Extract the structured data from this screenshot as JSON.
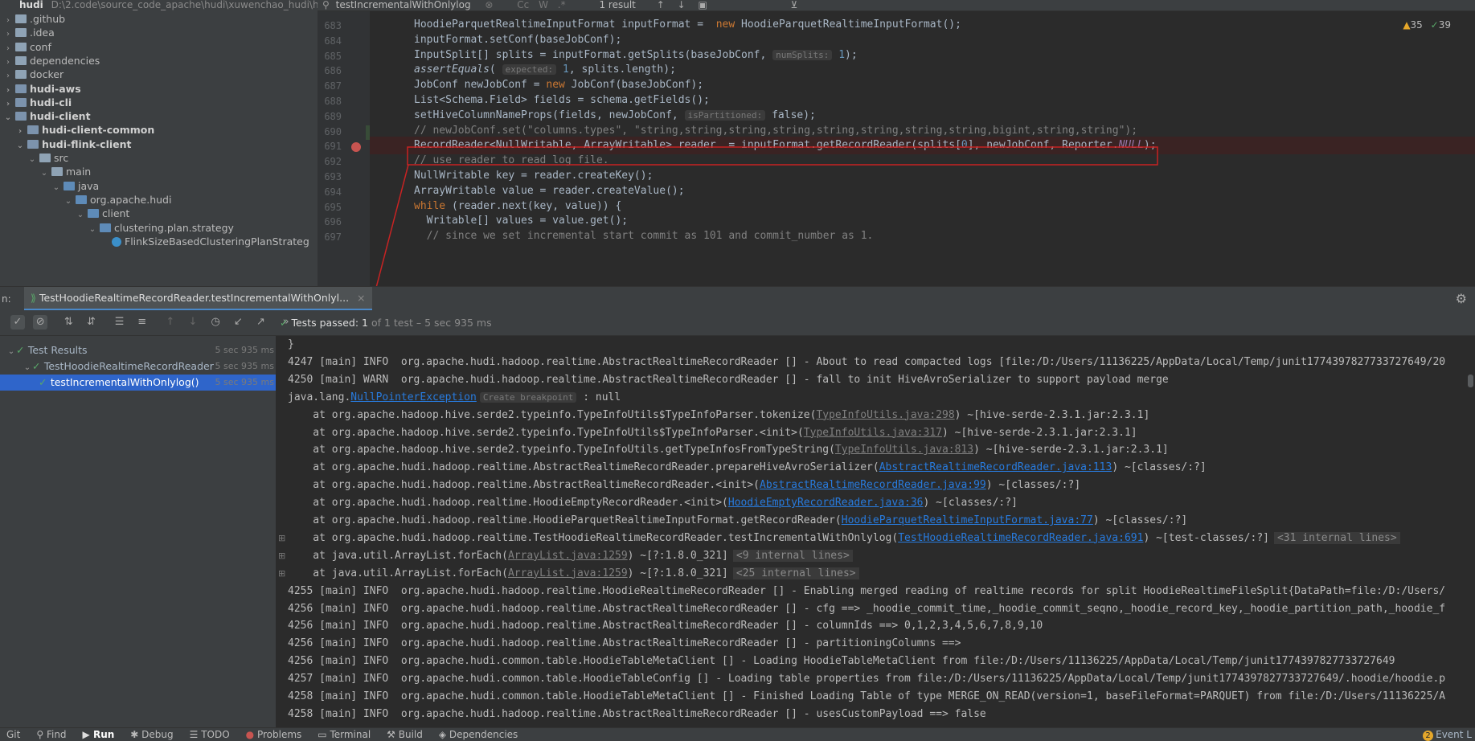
{
  "project": {
    "name": "hudi",
    "path": "D:\\2.code\\source_code_apache\\hudi\\xuwenchao_hudi\\hu",
    "tree": [
      {
        "label": ".github",
        "level": 0,
        "bold": false,
        "arrow": "right"
      },
      {
        "label": ".idea",
        "level": 0,
        "bold": false,
        "arrow": "right"
      },
      {
        "label": "conf",
        "level": 0,
        "bold": false,
        "arrow": "right"
      },
      {
        "label": "dependencies",
        "level": 0,
        "bold": false,
        "arrow": "right"
      },
      {
        "label": "docker",
        "level": 0,
        "bold": false,
        "arrow": "right"
      },
      {
        "label": "hudi-aws",
        "level": 0,
        "bold": true,
        "arrow": "right"
      },
      {
        "label": "hudi-cli",
        "level": 0,
        "bold": true,
        "arrow": "right"
      },
      {
        "label": "hudi-client",
        "level": 0,
        "bold": true,
        "arrow": "down"
      },
      {
        "label": "hudi-client-common",
        "level": 1,
        "bold": true,
        "arrow": "right"
      },
      {
        "label": "hudi-flink-client",
        "level": 1,
        "bold": true,
        "arrow": "down"
      },
      {
        "label": "src",
        "level": 2,
        "bold": false,
        "arrow": "down"
      },
      {
        "label": "main",
        "level": 3,
        "bold": false,
        "arrow": "down"
      },
      {
        "label": "java",
        "level": 4,
        "bold": false,
        "arrow": "down"
      },
      {
        "label": "org.apache.hudi",
        "level": 5,
        "bold": false,
        "arrow": "down"
      },
      {
        "label": "client",
        "level": 6,
        "bold": false,
        "arrow": "down"
      },
      {
        "label": "clustering.plan.strategy",
        "level": 7,
        "bold": false,
        "arrow": "down"
      },
      {
        "label": "FlinkSizeBasedClusteringPlanStrateg",
        "level": 8,
        "bold": false,
        "arrow": "none"
      }
    ]
  },
  "search": {
    "query": "testIncrementalWithOnlylog",
    "result": "1 result",
    "case": "Cc",
    "word": "W",
    "regex": ".*"
  },
  "inspections": {
    "warnings": "35",
    "ok": "39"
  },
  "code": {
    "lines": [
      {
        "n": "683",
        "text": "HoodieParquetRealtimeInputFormat inputFormat =  new HoodieParquetRealtimeInputFormat();"
      },
      {
        "n": "684",
        "text": "inputFormat.setConf(baseJobConf);"
      },
      {
        "n": "685",
        "text": "InputSplit[] splits = inputFormat.getSplits(baseJobConf, ",
        "hint": "numSplits:",
        "tail": " 1);"
      },
      {
        "n": "686",
        "text": "assertEquals( ",
        "hint": "expected:",
        "tail": " 1, splits.length);"
      },
      {
        "n": "687",
        "text": "JobConf newJobConf = new JobConf(baseJobConf);"
      },
      {
        "n": "688",
        "text": "List<Schema.Field> fields = schema.getFields();"
      },
      {
        "n": "689",
        "text": "setHiveColumnNameProps(fields, newJobConf, ",
        "hint": "isPartitioned:",
        "tail": " false);"
      },
      {
        "n": "690",
        "text": "// newJobConf.set(\"columns.types\", \"string,string,string,string,string,string,string,string,bigint,string,string\");"
      },
      {
        "n": "691",
        "text": "RecordReader<NullWritable, ArrayWritable> reader  = inputFormat.getRecordReader(splits[0], newJobConf, Reporter.",
        "null": "NULL",
        "tail": ");"
      },
      {
        "n": "692",
        "text": "// use reader to read log file."
      },
      {
        "n": "693",
        "text": "NullWritable key = reader.createKey();"
      },
      {
        "n": "694",
        "text": "ArrayWritable value = reader.createValue();"
      },
      {
        "n": "695",
        "text": "while (reader.next(key, value)) {"
      },
      {
        "n": "696",
        "text": "  Writable[] values = value.get();"
      },
      {
        "n": "697",
        "text": "  // since we set incremental start commit as 101 and commit_number as 1."
      }
    ]
  },
  "run": {
    "tab_prefix": "n:",
    "tab": "TestHoodieRealtimeRecordReader.testIncrementalWithOnlyl...",
    "status_label": "Tests passed:",
    "status_count": "1",
    "status_rest": "of 1 test – 5 sec 935 ms",
    "results": [
      {
        "label": "Test Results",
        "dur": "5 sec 935 ms",
        "level": 0
      },
      {
        "label": "TestHoodieRealtimeRecordReader",
        "dur": "5 sec 935 ms",
        "level": 1
      },
      {
        "label": "testIncrementalWithOnlylog()",
        "dur": "5 sec 935 ms",
        "level": 2
      }
    ]
  },
  "console": {
    "lines": [
      {
        "text": "}"
      },
      {
        "text": "4247 [main] INFO  org.apache.hudi.hadoop.realtime.AbstractRealtimeRecordReader [] - About to read compacted logs [file:/D:/Users/11136225/AppData/Local/Temp/junit1774397827733727649/20"
      },
      {
        "text": "4250 [main] WARN  org.apache.hudi.hadoop.realtime.AbstractRealtimeRecordReader [] - fall to init HiveAvroSerializer to support payload merge"
      },
      {
        "text": "java.lang.",
        "link": "NullPointerException",
        "hint": "Create breakpoint",
        "tail": " : null"
      },
      {
        "text": "    at org.apache.hadoop.hive.serde2.typeinfo.TypeInfoUtils$TypeInfoParser.tokenize(",
        "glink": "TypeInfoUtils.java:298",
        "tail": ") ~[hive-serde-2.3.1.jar:2.3.1]"
      },
      {
        "text": "    at org.apache.hadoop.hive.serde2.typeinfo.TypeInfoUtils$TypeInfoParser.<init>(",
        "glink": "TypeInfoUtils.java:317",
        "tail": ") ~[hive-serde-2.3.1.jar:2.3.1]"
      },
      {
        "text": "    at org.apache.hadoop.hive.serde2.typeinfo.TypeInfoUtils.getTypeInfosFromTypeString(",
        "glink": "TypeInfoUtils.java:813",
        "tail": ") ~[hive-serde-2.3.1.jar:2.3.1]"
      },
      {
        "text": "    at org.apache.hudi.hadoop.realtime.AbstractRealtimeRecordReader.prepareHiveAvroSerializer(",
        "link": "AbstractRealtimeRecordReader.java:113",
        "tail": ") ~[classes/:?]"
      },
      {
        "text": "    at org.apache.hudi.hadoop.realtime.AbstractRealtimeRecordReader.<init>(",
        "link": "AbstractRealtimeRecordReader.java:99",
        "tail": ") ~[classes/:?]"
      },
      {
        "text": "    at org.apache.hudi.hadoop.realtime.HoodieEmptyRecordReader.<init>(",
        "link": "HoodieEmptyRecordReader.java:36",
        "tail": ") ~[classes/:?]"
      },
      {
        "text": "    at org.apache.hudi.hadoop.realtime.HoodieParquetRealtimeInputFormat.getRecordReader(",
        "link": "HoodieParquetRealtimeInputFormat.java:77",
        "tail": ") ~[classes/:?]"
      },
      {
        "text": "    at org.apache.hudi.hadoop.realtime.TestHoodieRealtimeRecordReader.testIncrementalWithOnlylog(",
        "link": "TestHoodieRealtimeRecordReader.java:691",
        "tail": ") ~[test-classes/:?]",
        "fold": "<31 internal lines>"
      },
      {
        "text": "    at java.util.ArrayList.forEach(",
        "glink": "ArrayList.java:1259",
        "tail": ") ~[?:1.8.0_321]",
        "fold": "<9 internal lines>"
      },
      {
        "text": "    at java.util.ArrayList.forEach(",
        "glink": "ArrayList.java:1259",
        "tail": ") ~[?:1.8.0_321]",
        "fold": "<25 internal lines>"
      },
      {
        "text": "4255 [main] INFO  org.apache.hudi.hadoop.realtime.HoodieRealtimeRecordReader [] - Enabling merged reading of realtime records for split HoodieRealtimeFileSplit{DataPath=file:/D:/Users/"
      },
      {
        "text": "4256 [main] INFO  org.apache.hudi.hadoop.realtime.AbstractRealtimeRecordReader [] - cfg ==> _hoodie_commit_time,_hoodie_commit_seqno,_hoodie_record_key,_hoodie_partition_path,_hoodie_f"
      },
      {
        "text": "4256 [main] INFO  org.apache.hudi.hadoop.realtime.AbstractRealtimeRecordReader [] - columnIds ==> 0,1,2,3,4,5,6,7,8,9,10"
      },
      {
        "text": "4256 [main] INFO  org.apache.hudi.hadoop.realtime.AbstractRealtimeRecordReader [] - partitioningColumns ==>"
      },
      {
        "text": "4256 [main] INFO  org.apache.hudi.common.table.HoodieTableMetaClient [] - Loading HoodieTableMetaClient from file:/D:/Users/11136225/AppData/Local/Temp/junit1774397827733727649"
      },
      {
        "text": "4257 [main] INFO  org.apache.hudi.common.table.HoodieTableConfig [] - Loading table properties from file:/D:/Users/11136225/AppData/Local/Temp/junit1774397827733727649/.hoodie/hoodie.p"
      },
      {
        "text": "4258 [main] INFO  org.apache.hudi.common.table.HoodieTableMetaClient [] - Finished Loading Table of type MERGE_ON_READ(version=1, baseFileFormat=PARQUET) from file:/D:/Users/11136225/A"
      },
      {
        "text": "4258 [main] INFO  org.apache.hudi.hadoop.realtime.AbstractRealtimeRecordReader [] - usesCustomPayload ==> false"
      }
    ]
  },
  "statusbar": {
    "items": [
      "Git",
      "Find",
      "Run",
      "Debug",
      "TODO",
      "Problems",
      "Terminal",
      "Build",
      "Dependencies"
    ],
    "event_count": "2",
    "event_label": "Event L"
  },
  "colors": {
    "annotation": "#c82323",
    "pass": "#59a869",
    "link": "#287bde"
  }
}
